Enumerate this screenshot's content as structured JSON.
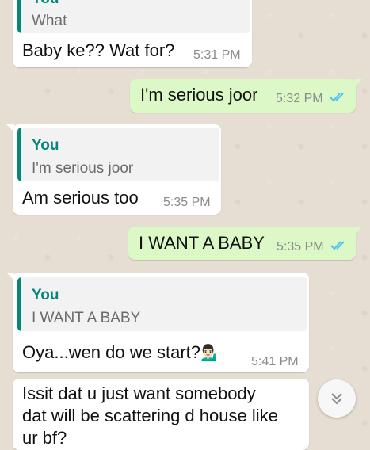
{
  "messages": [
    {
      "quote_author": "You",
      "quote_text": "What",
      "text": "Baby ke?? Wat for?",
      "time": "5:31 PM"
    },
    {
      "text": "I'm serious joor",
      "time": "5:32 PM"
    },
    {
      "quote_author": "You",
      "quote_text": "I'm serious joor",
      "text": "Am serious too",
      "time": "5:35 PM"
    },
    {
      "text": "I WANT A BABY",
      "time": "5:35 PM"
    },
    {
      "quote_author": "You",
      "quote_text": "I WANT A BABY",
      "text": "Oya...wen do we start?",
      "emoji": "💁🏻‍♂️",
      "time": "5:41 PM"
    },
    {
      "line1": "Issit dat u just want somebody",
      "line2": "dat will be scattering d house like",
      "line3": "ur bf?"
    }
  ],
  "colors": {
    "incoming": "#ffffff",
    "outgoing": "#dcf8c6",
    "quote_accent": "#06857a",
    "read_ticks": "#4fc3f7",
    "wallpaper": "#e6ddd3"
  },
  "icons": {
    "read_receipt": "double-check-icon",
    "scroll_down": "chevron-double-down-icon"
  }
}
